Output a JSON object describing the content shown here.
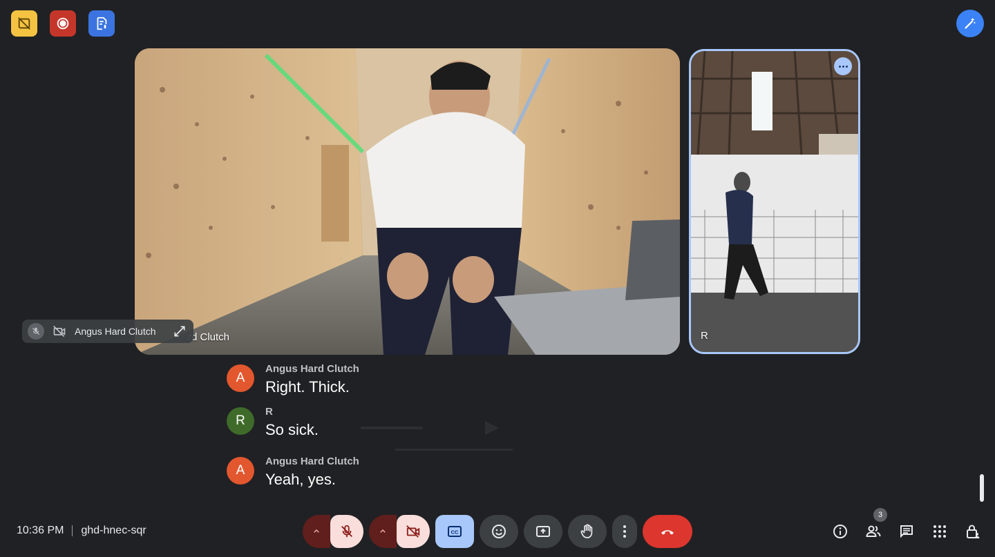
{
  "meeting": {
    "time": "10:36 PM",
    "code": "ghd-hnec-sqr"
  },
  "top_badges": [
    {
      "icon": "hd-off-icon",
      "color": "#f5c342"
    },
    {
      "icon": "record-icon",
      "color": "#c5362a"
    },
    {
      "icon": "transcript-icon",
      "color": "#3b74e0"
    }
  ],
  "ai_button_icon": "magic-pen-icon",
  "tiles": {
    "main": {
      "name": "Angus Hard Clutch",
      "name_visible": "rd Clutch"
    },
    "side": {
      "name": "R"
    }
  },
  "hover_pill": {
    "name": "Angus Hard Clutch"
  },
  "captions": [
    {
      "speaker": "Angus Hard Clutch",
      "initial": "A",
      "avatar_color": "#e2572e",
      "text": "Right. Thick."
    },
    {
      "speaker": "R",
      "initial": "R",
      "avatar_color": "#3f6b2a",
      "text": "So sick."
    },
    {
      "speaker": "Angus Hard Clutch",
      "initial": "A",
      "avatar_color": "#e2572e",
      "text": "Yeah, yes."
    }
  ],
  "controls": {
    "mic": "mic-off-icon",
    "camera": "camera-off-icon",
    "captions": "closed-captions-icon",
    "reactions": "emoji-icon",
    "present": "present-screen-icon",
    "raise_hand": "hand-icon",
    "more": "more-vert-icon",
    "end_call": "end-call-icon"
  },
  "right_tools": {
    "info": "info-icon",
    "people": "people-icon",
    "people_count": "3",
    "chat": "chat-icon",
    "activities": "apps-icon",
    "host_controls": "lock-person-icon"
  }
}
